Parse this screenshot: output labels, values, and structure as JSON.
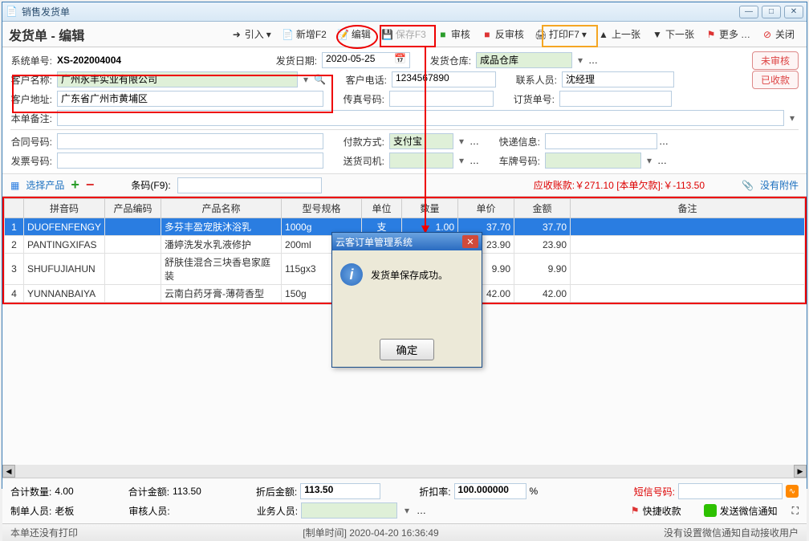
{
  "titlebar": {
    "title": "销售发货单"
  },
  "page": {
    "title": "发货单 - 编辑"
  },
  "toolbar": {
    "import": "引入",
    "new": "新增F2",
    "edit": "编辑",
    "save": "保存F3",
    "audit": "审核",
    "unaudit": "反审核",
    "print": "打印F7",
    "prev": "上一张",
    "next": "下一张",
    "more": "更多",
    "close": "关闭"
  },
  "form": {
    "sysno_label": "系统单号:",
    "sysno": "XS-202004004",
    "cust_name_label": "客户名称:",
    "cust_name": "广州永丰实业有限公司",
    "cust_addr_label": "客户地址:",
    "cust_addr": "广东省广州市黄埔区",
    "note_label": "本单备注:",
    "date_label": "发货日期:",
    "date": "2020-05-25",
    "phone_label": "客户电话:",
    "phone": "1234567890",
    "fax_label": "传真号码:",
    "warehouse_label": "发货仓库:",
    "warehouse": "成品仓库",
    "contact_label": "联系人员:",
    "contact": "沈经理",
    "orderno_label": "订货单号:",
    "contract_label": "合同号码:",
    "invoice_label": "发票号码:",
    "paymethod_label": "付款方式:",
    "paymethod": "支付宝",
    "driver_label": "送货司机:",
    "express_label": "快递信息:",
    "plate_label": "车牌号码:"
  },
  "status": {
    "unaudited": "未审核",
    "paid": "已收款"
  },
  "bar2": {
    "select_product": "选择产品",
    "barcode_label": "条码(F9):",
    "receivable_label": "应收账款:",
    "receivable": "￥271.10",
    "owe_label": "[本单欠款]:",
    "owe": "￥-113.50",
    "no_attach": "没有附件"
  },
  "grid": {
    "headers": {
      "idx": "",
      "pinyin": "拼音码",
      "code": "产品编码",
      "name": "产品名称",
      "spec": "型号规格",
      "unit": "单位",
      "qty": "数量",
      "price": "单价",
      "amount": "金额",
      "remark": "备注"
    },
    "rows": [
      {
        "idx": "1",
        "pinyin": "DUOFENFENGY",
        "code": "",
        "name": "多芬丰盈宠肤沐浴乳",
        "spec": "1000g",
        "unit": "支",
        "qty": "1.00",
        "price": "37.70",
        "amount": "37.70",
        "remark": ""
      },
      {
        "idx": "2",
        "pinyin": "PANTINGXIFAS",
        "code": "",
        "name": "潘婷洗发水乳液修护",
        "spec": "200ml",
        "unit": "",
        "qty": "",
        "price": "23.90",
        "amount": "23.90",
        "remark": ""
      },
      {
        "idx": "3",
        "pinyin": "SHUFUJIAHUN",
        "code": "",
        "name": "舒肤佳混合三块香皂家庭装",
        "spec": "115gx3",
        "unit": "",
        "qty": "",
        "price": "9.90",
        "amount": "9.90",
        "remark": ""
      },
      {
        "idx": "4",
        "pinyin": "YUNNANBAIYA",
        "code": "",
        "name": "云南白药牙膏-薄荷香型",
        "spec": "150g",
        "unit": "",
        "qty": "",
        "price": "42.00",
        "amount": "42.00",
        "remark": ""
      }
    ]
  },
  "dialog": {
    "title": "云客订单管理系统",
    "msg": "发货单保存成功。",
    "ok": "确定"
  },
  "totals": {
    "qty_label": "合计数量:",
    "qty": "4.00",
    "amt_label": "合计金额:",
    "amt": "113.50",
    "disc_amt_label": "折后金额:",
    "disc_amt": "113.50",
    "disc_rate_label": "折扣率:",
    "disc_rate": "100.000000",
    "pct": "%",
    "sms_label": "短信号码:",
    "maker_label": "制单人员:",
    "maker": "老板",
    "auditor_label": "审核人员:",
    "biz_label": "业务人员:",
    "quickpay": "快捷收款",
    "wechat": "发送微信通知"
  },
  "statusbar": {
    "left": "本单还没有打印",
    "mid": "[制单时间] 2020-04-20 16:36:49",
    "right": "没有设置微信通知自动接收用户"
  }
}
